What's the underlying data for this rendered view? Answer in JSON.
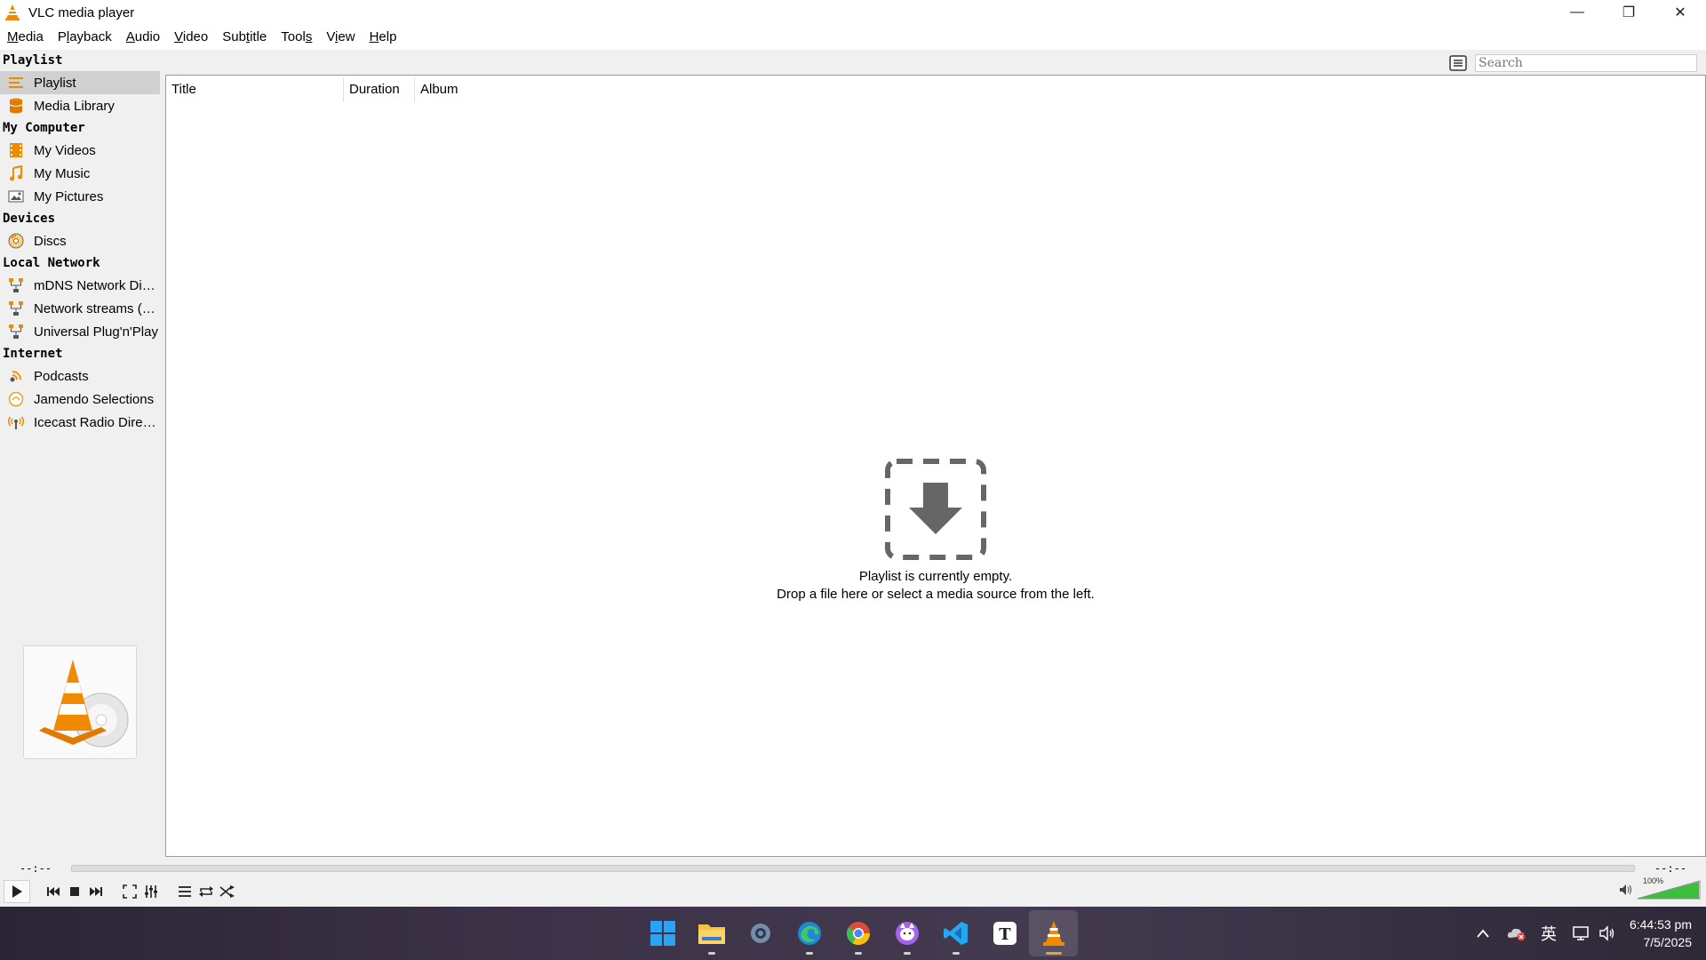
{
  "window": {
    "title": "VLC media player",
    "controls": {
      "minimize": "—",
      "restore": "❐",
      "close": "✕"
    }
  },
  "menu": [
    {
      "pre": "",
      "u": "M",
      "post": "edia"
    },
    {
      "pre": "P",
      "u": "l",
      "post": "ayback"
    },
    {
      "pre": "",
      "u": "A",
      "post": "udio"
    },
    {
      "pre": "",
      "u": "V",
      "post": "ideo"
    },
    {
      "pre": "Sub",
      "u": "t",
      "post": "itle"
    },
    {
      "pre": "Tool",
      "u": "s",
      "post": ""
    },
    {
      "pre": "V",
      "u": "i",
      "post": "ew"
    },
    {
      "pre": "",
      "u": "H",
      "post": "elp"
    }
  ],
  "sidebar": {
    "headers": {
      "playlist": "Playlist",
      "my_computer": "My Computer",
      "devices": "Devices",
      "local_network": "Local Network",
      "internet": "Internet"
    },
    "items": {
      "playlist": "Playlist",
      "media_library": "Media Library",
      "my_videos": "My Videos",
      "my_music": "My Music",
      "my_pictures": "My Pictures",
      "discs": "Discs",
      "mdns": "mDNS Network Dis...",
      "network_streams": "Network streams (S...",
      "upnp": "Universal Plug'n'Play",
      "podcasts": "Podcasts",
      "jamendo": "Jamendo Selections",
      "icecast": "Icecast Radio Direc..."
    }
  },
  "search": {
    "placeholder": "Search"
  },
  "playlist": {
    "columns": {
      "title": "Title",
      "duration": "Duration",
      "album": "Album"
    },
    "empty_line1": "Playlist is currently empty.",
    "empty_line2": "Drop a file here or select a media source from the left."
  },
  "player": {
    "elapsed": "--:--",
    "remaining": "--:--",
    "volume": "100%"
  },
  "taskbar": {
    "clock_time": "6:44:53 pm",
    "clock_date": "7/5/2025",
    "ime": "英"
  },
  "colors": {
    "vlc_orange": "#f08a00",
    "accent_green": "#3cbf3c"
  }
}
